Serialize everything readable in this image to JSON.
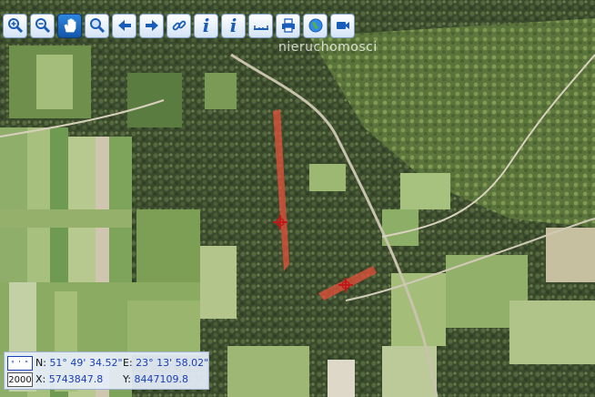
{
  "watermark": "nieruchomosci",
  "toolbar": {
    "buttons": [
      {
        "name": "zoom-in-button",
        "icon": "zoom-in-icon"
      },
      {
        "name": "zoom-out-button",
        "icon": "zoom-out-icon"
      },
      {
        "name": "pan-button",
        "icon": "hand-icon"
      },
      {
        "name": "zoom-window-button",
        "icon": "magnifier-icon"
      },
      {
        "name": "back-button",
        "icon": "arrow-left-icon"
      },
      {
        "name": "forward-button",
        "icon": "arrow-right-icon"
      },
      {
        "name": "link-button",
        "icon": "link-icon"
      },
      {
        "name": "info-button",
        "icon": "info-icon"
      },
      {
        "name": "info-select-button",
        "icon": "info-cursor-icon"
      },
      {
        "name": "measure-button",
        "icon": "ruler-icon"
      },
      {
        "name": "print-button",
        "icon": "printer-icon"
      },
      {
        "name": "globe-button",
        "icon": "globe-icon"
      },
      {
        "name": "video-button",
        "icon": "camera-icon"
      }
    ]
  },
  "coords": {
    "format_label": "° ' \"",
    "scale": "2000",
    "n_label": "N:",
    "n_value": "51° 49' 34.52\"",
    "e_label": "E:",
    "e_value": "23° 13' 58.02\"",
    "x_label": "X:",
    "x_value": "5743847.8",
    "y_label": "Y:",
    "y_value": "8447109.8"
  },
  "colors": {
    "parcel": "#e0503a",
    "marker": "#c01818",
    "toolbar_accent": "#1a5db8"
  }
}
